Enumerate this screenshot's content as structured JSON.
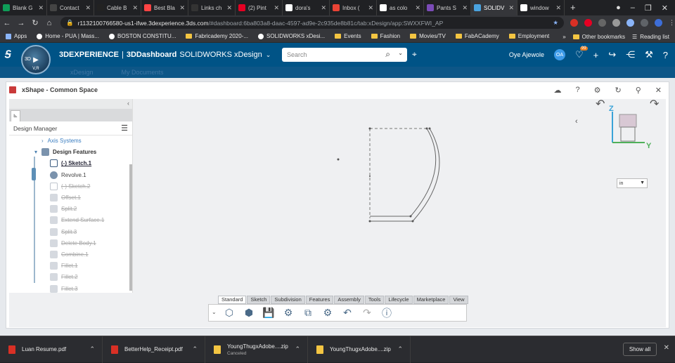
{
  "browser": {
    "tabs": [
      {
        "label": "Blank G",
        "color": "#0f9d58"
      },
      {
        "label": "Contact",
        "color": "#444444"
      },
      {
        "label": "Cable B",
        "color": "#222222"
      },
      {
        "label": "Best Bla",
        "color": "#ff4444"
      },
      {
        "label": "Links ch",
        "color": "#333333"
      },
      {
        "label": "(2) Pint",
        "color": "#e60023"
      },
      {
        "label": "dora's",
        "color": "#ffffff"
      },
      {
        "label": "Inbox (",
        "color": "#ea4335"
      },
      {
        "label": "as colo",
        "color": "#ffffff"
      },
      {
        "label": "Pants S",
        "color": "#7b4bb7"
      },
      {
        "label": "SOLIDV",
        "color": "#4aa3df"
      },
      {
        "label": "window",
        "color": "#ffffff"
      }
    ],
    "url_host": "r1132100766580-us1-ifwe.3dexperience.3ds.com",
    "url_rest": "/#dashboard:6ba803a8-daac-4597-ad9e-2c935de8b81c/tab:xDesign/app:SWXXFWI_AP",
    "bookmarks": [
      "Apps",
      "Home - PUA | Mass...",
      "BOSTON CONSTITU...",
      "Fabricademy 2020-...",
      "SOLIDWORKS xDesi...",
      "Events",
      "Fashion",
      "Movies/TV",
      "FabACademy",
      "Employment"
    ],
    "other_bookmarks": "Other bookmarks",
    "reading_list": "Reading list",
    "more": "»"
  },
  "app": {
    "brand_3dx": "3DEXPERIENCE",
    "separator": "|",
    "dashboard": "3DDashboard",
    "app_name": "SOLIDWORKS xDesign",
    "search_placeholder": "Search",
    "user_name": "Oye Ajewole",
    "user_initials": "OA",
    "notif_count": "99",
    "compass_label": "3D",
    "compass_sub": "V,R",
    "subtabs": [
      "xDesign",
      "My Documents"
    ]
  },
  "panel": {
    "title": "xShape - Common Space"
  },
  "tree": {
    "title": "Design Manager",
    "items": [
      {
        "label": "Axis Systems",
        "state": "link"
      },
      {
        "label": "Design Features",
        "state": "bold"
      },
      {
        "label": "(-)  Sketch.1",
        "state": "active"
      },
      {
        "label": "Revolve.1",
        "state": "normal"
      },
      {
        "label": "(-)  Sketch.2",
        "state": "disabled"
      },
      {
        "label": "Offset.1",
        "state": "disabled"
      },
      {
        "label": "Split.2",
        "state": "disabled"
      },
      {
        "label": "Extend Surface.1",
        "state": "disabled"
      },
      {
        "label": "Split.3",
        "state": "disabled"
      },
      {
        "label": "Delete Body.1",
        "state": "disabled"
      },
      {
        "label": "Combine.1",
        "state": "disabled"
      },
      {
        "label": "Fillet.1",
        "state": "disabled"
      },
      {
        "label": "Fillet.2",
        "state": "disabled"
      },
      {
        "label": "Fillet.3",
        "state": "disabled"
      }
    ]
  },
  "view": {
    "units": "in",
    "axis_z": "Z",
    "axis_y": "Y"
  },
  "toolbar": {
    "tabs": [
      "Standard",
      "Sketch",
      "Subdivision",
      "Features",
      "Assembly",
      "Tools",
      "Lifecycle",
      "Marketplace",
      "View"
    ],
    "active_tab": "Standard"
  },
  "downloads": [
    {
      "name": "Luan Resume.pdf",
      "sub": "",
      "color": "#d93025"
    },
    {
      "name": "BetterHelp_Receipt.pdf",
      "sub": "",
      "color": "#d93025"
    },
    {
      "name": "YoungThugxAdobe....zip",
      "sub": "Canceled",
      "color": "#f4c542"
    },
    {
      "name": "YoungThugxAdobe....zip",
      "sub": "",
      "color": "#f4c542"
    }
  ],
  "show_all": "Show all"
}
